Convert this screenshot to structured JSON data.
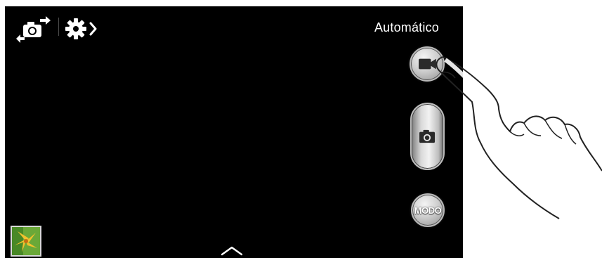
{
  "top_bar": {
    "switch_camera_icon": "switch-camera-icon",
    "settings_icon": "gear-arrow-icon",
    "mode_label": "Automático"
  },
  "controls": {
    "record_icon": "video-camera-icon",
    "photo_icon": "camera-icon",
    "mode_button_label": "MODO"
  },
  "bottom_bar": {
    "gallery_icon": "gallery-thumbnail",
    "expand_icon": "chevron-up-icon"
  },
  "colors": {
    "viewfinder": "#000000",
    "text": "#ffffff",
    "button_silver": "#d0d0d0"
  }
}
